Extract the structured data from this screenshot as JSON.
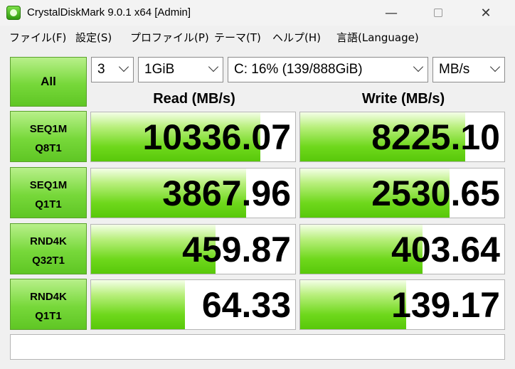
{
  "window": {
    "title": "CrystalDiskMark 9.0.1 x64 [Admin]"
  },
  "menu": [
    "ファイル(F)",
    "設定(S)",
    "プロファイル(P)",
    "テーマ(T)",
    "ヘルプ(H)",
    "言語(Language)"
  ],
  "controls": {
    "all_label": "All",
    "count": "3",
    "size": "1GiB",
    "drive": "C: 16% (139/888GiB)",
    "unit": "MB/s"
  },
  "headers": {
    "read": "Read (MB/s)",
    "write": "Write (MB/s)"
  },
  "tests": [
    {
      "line1": "SEQ1M",
      "line2": "Q8T1",
      "read": "10336.07",
      "write": "8225.10",
      "read_fill": 0.83,
      "write_fill": 0.81
    },
    {
      "line1": "SEQ1M",
      "line2": "Q1T1",
      "read": "3867.96",
      "write": "2530.65",
      "read_fill": 0.76,
      "write_fill": 0.73
    },
    {
      "line1": "RND4K",
      "line2": "Q32T1",
      "read": "459.87",
      "write": "403.64",
      "read_fill": 0.61,
      "write_fill": 0.6
    },
    {
      "line1": "RND4K",
      "line2": "Q1T1",
      "read": "64.33",
      "write": "139.17",
      "read_fill": 0.46,
      "write_fill": 0.52
    }
  ],
  "status_text": ""
}
